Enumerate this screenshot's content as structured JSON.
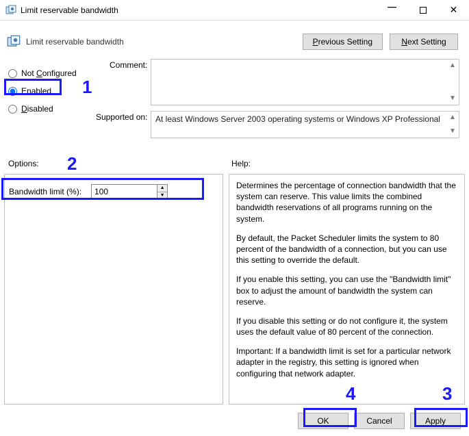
{
  "window": {
    "title": "Limit reservable bandwidth"
  },
  "header": {
    "title": "Limit reservable bandwidth",
    "prev_label_pre": "P",
    "prev_label_post": "revious Setting",
    "next_label_pre": "N",
    "next_label_post": "ext Setting"
  },
  "radios": {
    "not_configured": "Not Configured",
    "enabled": "Enabled",
    "disabled": "Disabled",
    "underline_c": "C",
    "underline_e": "E",
    "underline_d": "D",
    "not_configured_rest": "onfigured",
    "enabled_rest": "nabled",
    "disabled_rest": "isabled",
    "not_prefix": "Not "
  },
  "fields": {
    "comment_label": "Comment:",
    "comment_value": "",
    "supported_label": "Supported on:",
    "supported_value": "At least Windows Server 2003 operating systems or Windows XP Professional"
  },
  "mid": {
    "options_label": "Options:",
    "help_label": "Help:"
  },
  "options": {
    "bandwidth_label": "Bandwidth limit (%):",
    "bandwidth_value": "100"
  },
  "help": {
    "p1": "Determines the percentage of connection bandwidth that the system can reserve. This value limits the combined bandwidth reservations of all programs running on the system.",
    "p2": "By default, the Packet Scheduler limits the system to 80 percent of the bandwidth of a connection, but you can use this setting to override the default.",
    "p3": "If you enable this setting, you can use the \"Bandwidth limit\" box to adjust the amount of bandwidth the system can reserve.",
    "p4": "If you disable this setting or do not configure it, the system uses the default value of 80 percent of the connection.",
    "p5": "Important: If a bandwidth limit is set for a particular network adapter in the registry, this setting is ignored when configuring that network adapter."
  },
  "buttons": {
    "ok": "OK",
    "cancel": "Cancel",
    "apply": "Apply"
  },
  "annotations": {
    "n1": "1",
    "n2": "2",
    "n3": "3",
    "n4": "4"
  }
}
